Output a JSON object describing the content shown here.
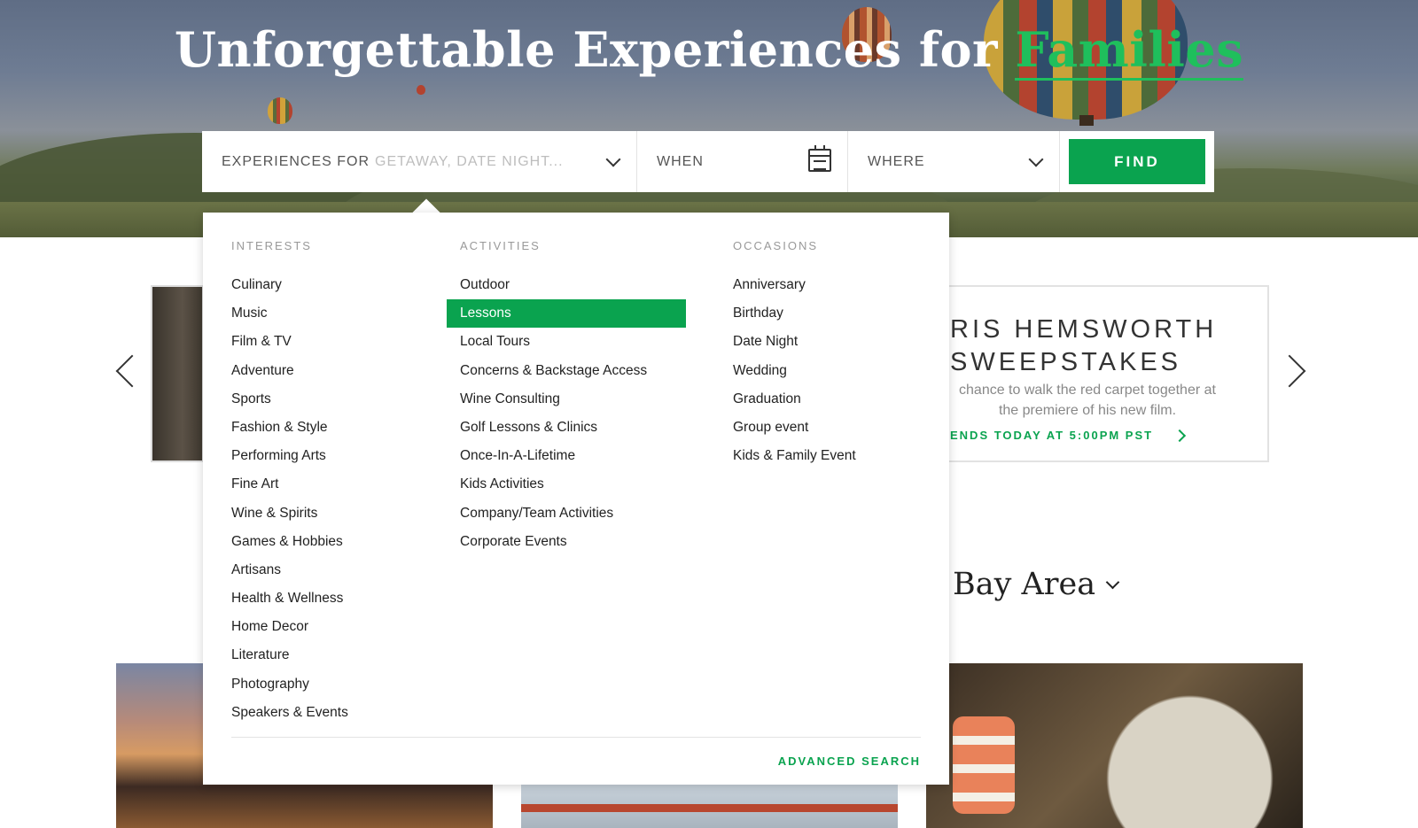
{
  "hero": {
    "title": "Unforgettable Experiences for ",
    "title_accent": "Families"
  },
  "search": {
    "experiences_label": "Experiences for",
    "experiences_placeholder": "Getaway, Date Night...",
    "when_label": "When",
    "where_label": "Where",
    "find_label": "FIND"
  },
  "dropdown": {
    "interests": {
      "heading": "INTERESTS",
      "items": [
        "Culinary",
        "Music",
        "Film & TV",
        "Adventure",
        "Sports",
        "Fashion & Style",
        "Performing Arts",
        "Fine Art",
        "Wine & Spirits",
        "Games & Hobbies",
        "Artisans",
        "Health & Wellness",
        "Home Decor",
        "Literature",
        "Photography",
        "Speakers & Events"
      ]
    },
    "activities": {
      "heading": "ACTIVITIES",
      "items": [
        "Outdoor",
        "Lessons",
        "Local Tours",
        "Concerns & Backstage Access",
        "Wine Consulting",
        "Golf Lessons & Clinics",
        "Once-In-A-Lifetime",
        "Kids Activities",
        "Company/Team Activities",
        "Corporate Events"
      ],
      "selected": "Lessons"
    },
    "occasions": {
      "heading": "OCCASIONS",
      "items": [
        "Anniversary",
        "Birthday",
        "Date Night",
        "Wedding",
        "Graduation",
        "Group event",
        "Kids & Family Event"
      ]
    },
    "advanced_search": "ADVANCED SEARCH"
  },
  "promo": {
    "title_line1": "RIS HEMSWORTH",
    "title_line2": "SWEEPSTAKES",
    "subtitle": "chance to walk the red carpet together at the premiere of his new film.",
    "cta": "ENDS TODAY AT 5:00PM PST"
  },
  "region": {
    "title": "Bay Area"
  },
  "colors": {
    "accent": "#0aa34f",
    "hero_accent": "#1fbf5c"
  }
}
